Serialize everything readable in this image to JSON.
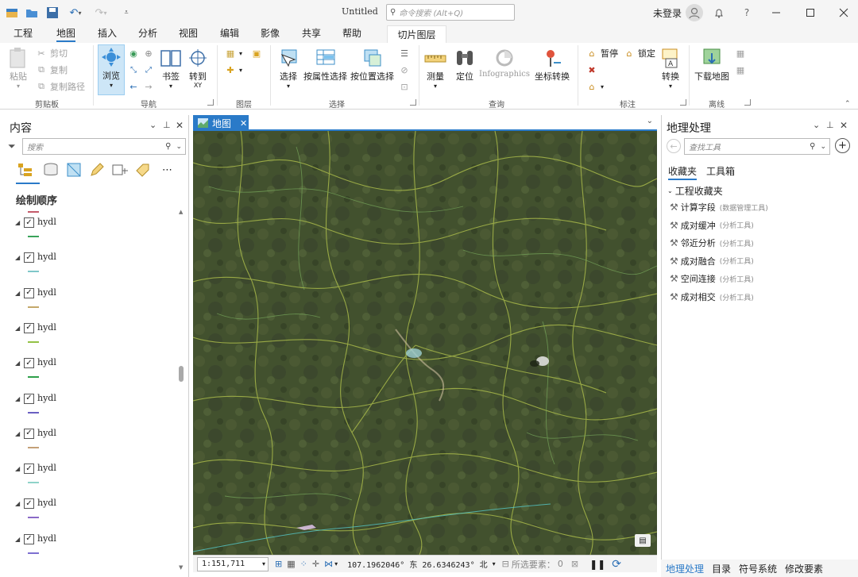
{
  "titlebar": {
    "doc_title": "Untitled",
    "search_placeholder": "命令搜索 (Alt+Q)",
    "user": "未登录"
  },
  "menu": {
    "tabs": [
      "工程",
      "地图",
      "插入",
      "分析",
      "视图",
      "编辑",
      "影像",
      "共享",
      "帮助"
    ],
    "active_tab": "地图",
    "contextual_tab": "切片图层"
  },
  "ribbon": {
    "clipboard": {
      "paste": "粘贴",
      "cut": "剪切",
      "copy": "复制",
      "copy_path": "复制路径",
      "label": "剪贴板"
    },
    "navigate": {
      "explore": "浏览",
      "bookmarks": "书签",
      "goto_xy": "转到",
      "goto_xy_sub": "XY",
      "label": "导航"
    },
    "layer": {
      "label": "图层"
    },
    "selection": {
      "select": "选择",
      "by_attr": "按属性选择",
      "by_loc": "按位置选择",
      "label": "选择"
    },
    "inquiry": {
      "measure": "测量",
      "locate": "定位",
      "infographics": "Infographics",
      "coord_convert": "坐标转换",
      "label": "查询"
    },
    "labeling": {
      "pause": "暂停",
      "lock": "锁定",
      "convert": "转换",
      "label": "标注"
    },
    "offline": {
      "download_map": "下载地图",
      "label": "离线"
    }
  },
  "contents": {
    "title": "内容",
    "search_placeholder": "搜索",
    "section": "绘制顺序",
    "layers": [
      {
        "name": "hydl",
        "color": "#3aa35a"
      },
      {
        "name": "hydl",
        "color": "#7fc7c9"
      },
      {
        "name": "hydl",
        "color": "#c4a86a"
      },
      {
        "name": "hydl",
        "color": "#94c246"
      },
      {
        "name": "hydl",
        "color": "#2fa04a"
      },
      {
        "name": "hydl",
        "color": "#6a5fc2"
      },
      {
        "name": "hydl",
        "color": "#c4a078"
      },
      {
        "name": "hydl",
        "color": "#8fd3c9"
      },
      {
        "name": "hydl",
        "color": "#8a6ac7"
      },
      {
        "name": "hydl",
        "color": "#7d6fd0"
      }
    ]
  },
  "map": {
    "tab_label": "地图",
    "scale": "1:151,711",
    "coords": "107.1962046° 东 26.6346243° 北",
    "selected_label": "所选要素：",
    "selected_count": "0"
  },
  "geoprocessing": {
    "title": "地理处理",
    "search_placeholder": "查找工具",
    "tabs": [
      "收藏夹",
      "工具箱"
    ],
    "group": "工程收藏夹",
    "tools": [
      {
        "name": "计算字段",
        "category": "(数据管理工具)"
      },
      {
        "name": "成对缓冲",
        "category": "(分析工具)"
      },
      {
        "name": "邻近分析",
        "category": "(分析工具)"
      },
      {
        "name": "成对融合",
        "category": "(分析工具)"
      },
      {
        "name": "空间连接",
        "category": "(分析工具)"
      },
      {
        "name": "成对相交",
        "category": "(分析工具)"
      }
    ]
  },
  "bottom_tabs": [
    "地理处理",
    "目录",
    "符号系统",
    "修改要素"
  ]
}
